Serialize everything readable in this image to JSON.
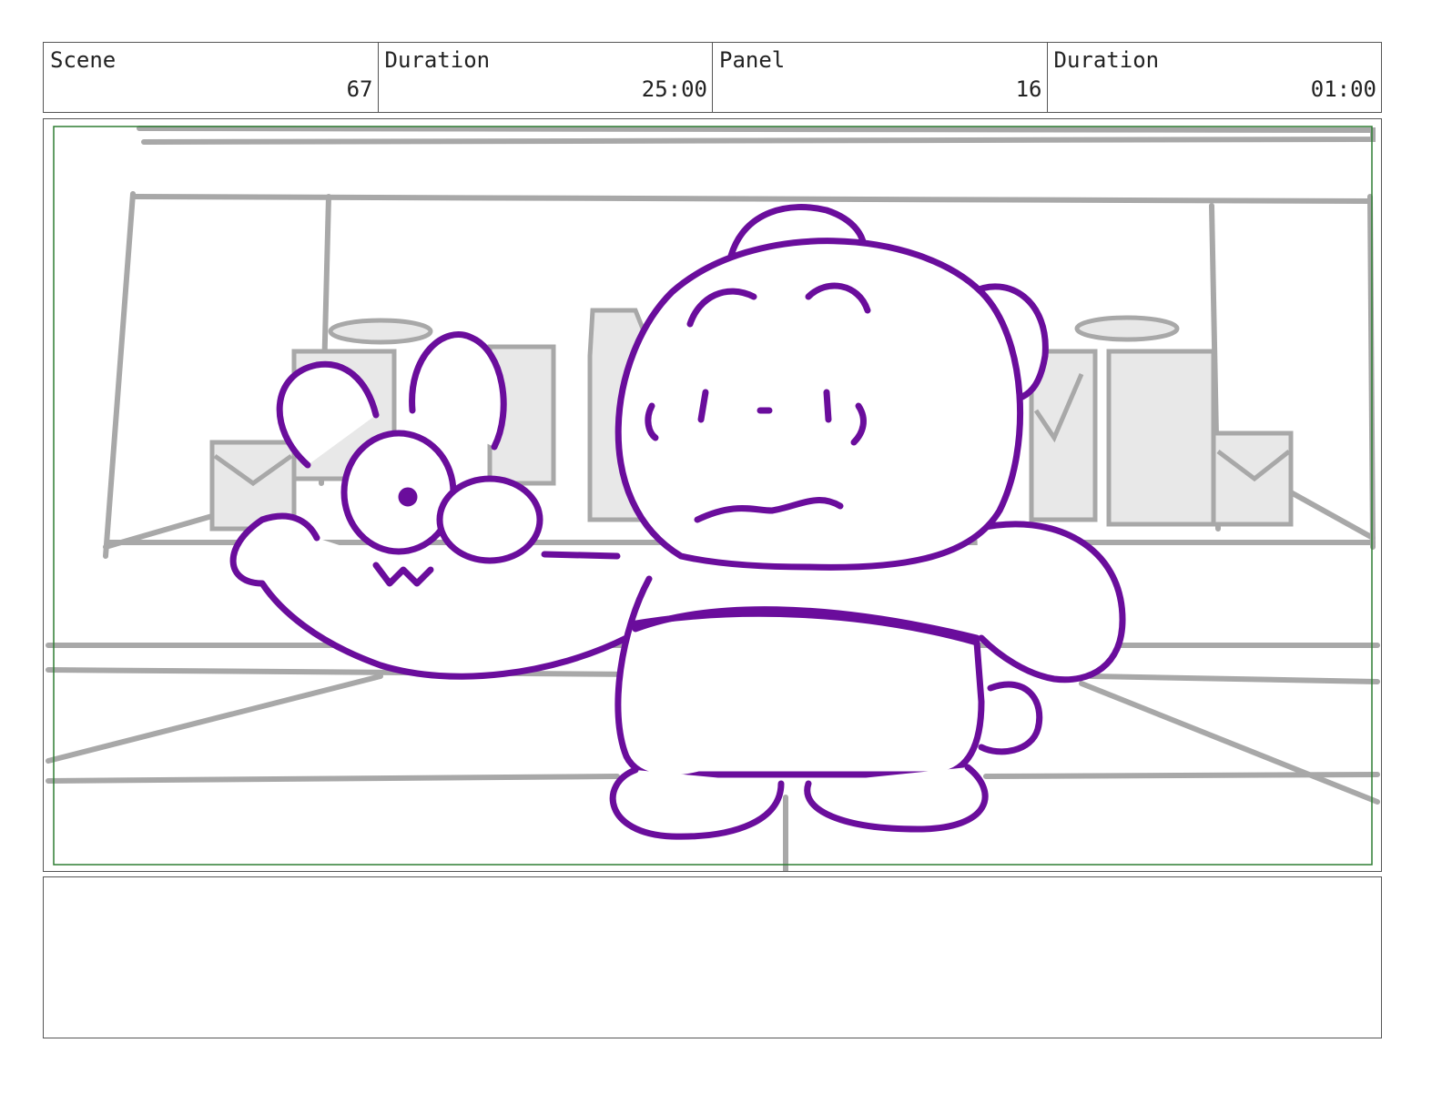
{
  "header": {
    "scene_label": "Scene",
    "scene_value": "67",
    "scene_duration_label": "Duration",
    "scene_duration_value": "25:00",
    "panel_label": "Panel",
    "panel_value": "16",
    "panel_duration_label": "Duration",
    "panel_duration_value": "01:00"
  },
  "notes": {
    "text": ""
  },
  "colors": {
    "character_line": "#6a0d9c",
    "background_line": "#a8a8a8",
    "safe_frame": "#2e7d32"
  }
}
